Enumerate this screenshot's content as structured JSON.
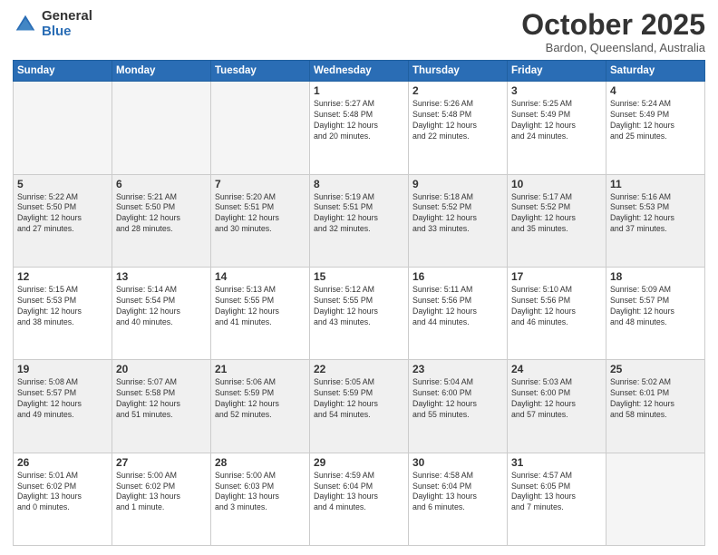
{
  "logo": {
    "general": "General",
    "blue": "Blue"
  },
  "header": {
    "month": "October 2025",
    "location": "Bardon, Queensland, Australia"
  },
  "weekdays": [
    "Sunday",
    "Monday",
    "Tuesday",
    "Wednesday",
    "Thursday",
    "Friday",
    "Saturday"
  ],
  "weeks": [
    [
      {
        "day": "",
        "text": ""
      },
      {
        "day": "",
        "text": ""
      },
      {
        "day": "",
        "text": ""
      },
      {
        "day": "1",
        "text": "Sunrise: 5:27 AM\nSunset: 5:48 PM\nDaylight: 12 hours\nand 20 minutes."
      },
      {
        "day": "2",
        "text": "Sunrise: 5:26 AM\nSunset: 5:48 PM\nDaylight: 12 hours\nand 22 minutes."
      },
      {
        "day": "3",
        "text": "Sunrise: 5:25 AM\nSunset: 5:49 PM\nDaylight: 12 hours\nand 24 minutes."
      },
      {
        "day": "4",
        "text": "Sunrise: 5:24 AM\nSunset: 5:49 PM\nDaylight: 12 hours\nand 25 minutes."
      }
    ],
    [
      {
        "day": "5",
        "text": "Sunrise: 5:22 AM\nSunset: 5:50 PM\nDaylight: 12 hours\nand 27 minutes."
      },
      {
        "day": "6",
        "text": "Sunrise: 5:21 AM\nSunset: 5:50 PM\nDaylight: 12 hours\nand 28 minutes."
      },
      {
        "day": "7",
        "text": "Sunrise: 5:20 AM\nSunset: 5:51 PM\nDaylight: 12 hours\nand 30 minutes."
      },
      {
        "day": "8",
        "text": "Sunrise: 5:19 AM\nSunset: 5:51 PM\nDaylight: 12 hours\nand 32 minutes."
      },
      {
        "day": "9",
        "text": "Sunrise: 5:18 AM\nSunset: 5:52 PM\nDaylight: 12 hours\nand 33 minutes."
      },
      {
        "day": "10",
        "text": "Sunrise: 5:17 AM\nSunset: 5:52 PM\nDaylight: 12 hours\nand 35 minutes."
      },
      {
        "day": "11",
        "text": "Sunrise: 5:16 AM\nSunset: 5:53 PM\nDaylight: 12 hours\nand 37 minutes."
      }
    ],
    [
      {
        "day": "12",
        "text": "Sunrise: 5:15 AM\nSunset: 5:53 PM\nDaylight: 12 hours\nand 38 minutes."
      },
      {
        "day": "13",
        "text": "Sunrise: 5:14 AM\nSunset: 5:54 PM\nDaylight: 12 hours\nand 40 minutes."
      },
      {
        "day": "14",
        "text": "Sunrise: 5:13 AM\nSunset: 5:55 PM\nDaylight: 12 hours\nand 41 minutes."
      },
      {
        "day": "15",
        "text": "Sunrise: 5:12 AM\nSunset: 5:55 PM\nDaylight: 12 hours\nand 43 minutes."
      },
      {
        "day": "16",
        "text": "Sunrise: 5:11 AM\nSunset: 5:56 PM\nDaylight: 12 hours\nand 44 minutes."
      },
      {
        "day": "17",
        "text": "Sunrise: 5:10 AM\nSunset: 5:56 PM\nDaylight: 12 hours\nand 46 minutes."
      },
      {
        "day": "18",
        "text": "Sunrise: 5:09 AM\nSunset: 5:57 PM\nDaylight: 12 hours\nand 48 minutes."
      }
    ],
    [
      {
        "day": "19",
        "text": "Sunrise: 5:08 AM\nSunset: 5:57 PM\nDaylight: 12 hours\nand 49 minutes."
      },
      {
        "day": "20",
        "text": "Sunrise: 5:07 AM\nSunset: 5:58 PM\nDaylight: 12 hours\nand 51 minutes."
      },
      {
        "day": "21",
        "text": "Sunrise: 5:06 AM\nSunset: 5:59 PM\nDaylight: 12 hours\nand 52 minutes."
      },
      {
        "day": "22",
        "text": "Sunrise: 5:05 AM\nSunset: 5:59 PM\nDaylight: 12 hours\nand 54 minutes."
      },
      {
        "day": "23",
        "text": "Sunrise: 5:04 AM\nSunset: 6:00 PM\nDaylight: 12 hours\nand 55 minutes."
      },
      {
        "day": "24",
        "text": "Sunrise: 5:03 AM\nSunset: 6:00 PM\nDaylight: 12 hours\nand 57 minutes."
      },
      {
        "day": "25",
        "text": "Sunrise: 5:02 AM\nSunset: 6:01 PM\nDaylight: 12 hours\nand 58 minutes."
      }
    ],
    [
      {
        "day": "26",
        "text": "Sunrise: 5:01 AM\nSunset: 6:02 PM\nDaylight: 13 hours\nand 0 minutes."
      },
      {
        "day": "27",
        "text": "Sunrise: 5:00 AM\nSunset: 6:02 PM\nDaylight: 13 hours\nand 1 minute."
      },
      {
        "day": "28",
        "text": "Sunrise: 5:00 AM\nSunset: 6:03 PM\nDaylight: 13 hours\nand 3 minutes."
      },
      {
        "day": "29",
        "text": "Sunrise: 4:59 AM\nSunset: 6:04 PM\nDaylight: 13 hours\nand 4 minutes."
      },
      {
        "day": "30",
        "text": "Sunrise: 4:58 AM\nSunset: 6:04 PM\nDaylight: 13 hours\nand 6 minutes."
      },
      {
        "day": "31",
        "text": "Sunrise: 4:57 AM\nSunset: 6:05 PM\nDaylight: 13 hours\nand 7 minutes."
      },
      {
        "day": "",
        "text": ""
      }
    ]
  ]
}
